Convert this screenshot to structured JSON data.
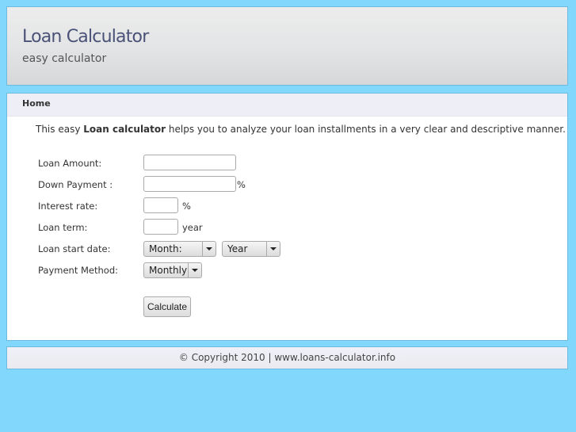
{
  "header": {
    "title": "Loan Calculator",
    "tagline": "easy calculator"
  },
  "nav": {
    "home": "Home"
  },
  "intro": {
    "prefix": "This easy ",
    "bold": "Loan calculator",
    "suffix": " helps you to analyze your loan installments in a very clear and descriptive manner."
  },
  "form": {
    "loan_amount": {
      "label": "Loan Amount:",
      "value": ""
    },
    "down_payment": {
      "label": "Down Payment :",
      "value": "",
      "suffix": "%"
    },
    "interest_rate": {
      "label": "Interest rate:",
      "value": "",
      "suffix": "%"
    },
    "loan_term": {
      "label": "Loan term:",
      "value": "",
      "suffix": "year"
    },
    "start_date": {
      "label": "Loan start date:",
      "month": "Month:",
      "year": "Year"
    },
    "payment_method": {
      "label": "Payment Method:",
      "value": "Monthly"
    },
    "calculate": "Calculate"
  },
  "footer": {
    "text": "© Copyright 2010 | www.loans-calculator.info"
  },
  "colors": {
    "background": "#82d8fc",
    "title": "#4a5278"
  }
}
